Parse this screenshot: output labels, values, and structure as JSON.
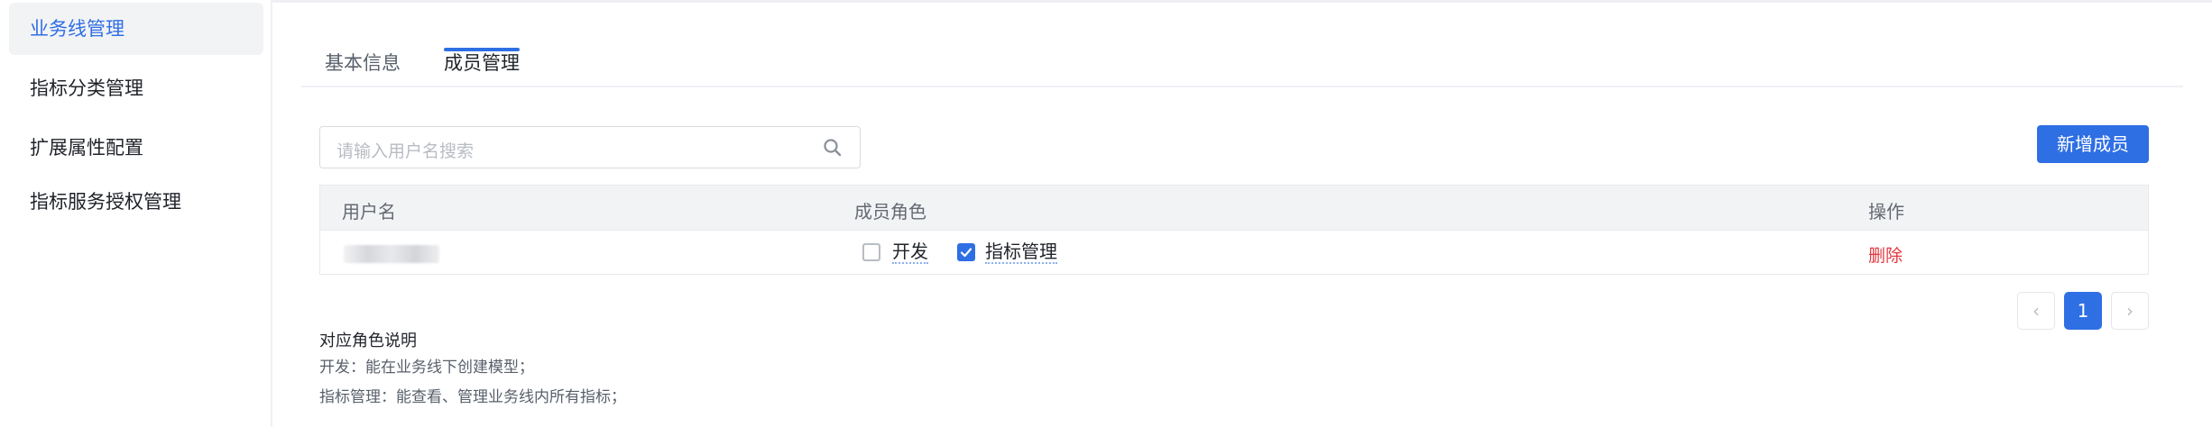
{
  "sidebar": {
    "items": [
      {
        "label": "业务线管理"
      },
      {
        "label": "指标分类管理"
      },
      {
        "label": "扩展属性配置"
      },
      {
        "label": "指标服务授权管理"
      }
    ]
  },
  "tabs": [
    {
      "label": "基本信息"
    },
    {
      "label": "成员管理"
    }
  ],
  "search": {
    "placeholder": "请输入用户名搜索"
  },
  "toolbar": {
    "add_label": "新增成员"
  },
  "table": {
    "headers": {
      "username": "用户名",
      "role": "成员角色",
      "action": "操作"
    },
    "rows": [
      {
        "roles": [
          {
            "label": "开发",
            "checked": false
          },
          {
            "label": "指标管理",
            "checked": true
          }
        ],
        "action": "删除"
      }
    ]
  },
  "pagination": {
    "current": "1",
    "prev": "‹",
    "next": "›"
  },
  "notes": {
    "title": "对应角色说明",
    "lines": [
      "开发：能在业务线下创建模型；",
      "指标管理：能查看、管理业务线内所有指标；"
    ]
  },
  "colors": {
    "accent": "#2f6fe4",
    "danger": "#e2383e"
  }
}
